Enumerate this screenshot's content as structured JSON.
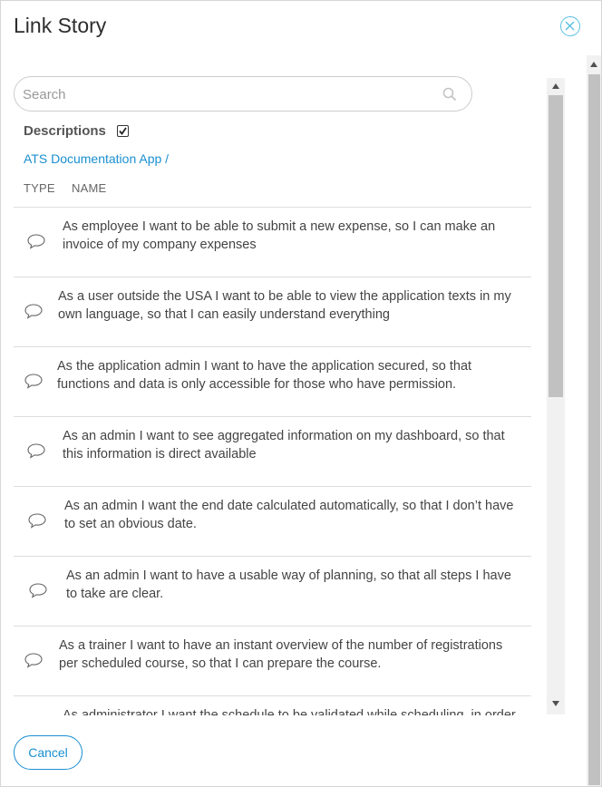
{
  "dialog": {
    "title": "Link Story",
    "close_icon": "close-circle-icon"
  },
  "search": {
    "placeholder": "Search",
    "value": "",
    "icon": "search-icon"
  },
  "descriptions": {
    "label": "Descriptions",
    "checked": true
  },
  "breadcrumb": "ATS Documentation App /",
  "columns": {
    "type": "TYPE",
    "name": "NAME"
  },
  "stories": [
    {
      "line1": "As employee I want to be able to submit a new expense, so I can make an",
      "line2": "invoice of my company expenses",
      "icon": "comment-bubble-icon"
    },
    {
      "line1": "As a user outside the USA I want to be able to view the application texts in my",
      "line2": "own language, so that I can easily understand everything",
      "icon": "comment-bubble-icon"
    },
    {
      "line1": "As the application admin I want to have the application secured, so that",
      "line2": "functions and data is only accessible for those who have permission.",
      "icon": "comment-bubble-icon"
    },
    {
      "line1": "As an admin I want to see aggregated information on my dashboard, so that",
      "line2": "this information is direct available",
      "icon": "comment-bubble-icon"
    },
    {
      "line1": "As an admin I want the end date calculated automatically, so that I don’t have",
      "line2": "to set an obvious date.",
      "icon": "comment-bubble-icon"
    },
    {
      "line1": "As an admin I want to have a usable way of planning, so that all steps I have",
      "line2": "to take are clear.",
      "icon": "comment-bubble-icon"
    },
    {
      "line1": "As a trainer I want to have an instant overview of the number of registrations",
      "line2": "per scheduled course, so that I can prepare the course.",
      "icon": "comment-bubble-icon"
    },
    {
      "line1": "As administrator I want the schedule to be validated while scheduling, in order",
      "line2": "",
      "icon": "comment-bubble-icon"
    }
  ],
  "footer": {
    "cancel_label": "Cancel"
  }
}
